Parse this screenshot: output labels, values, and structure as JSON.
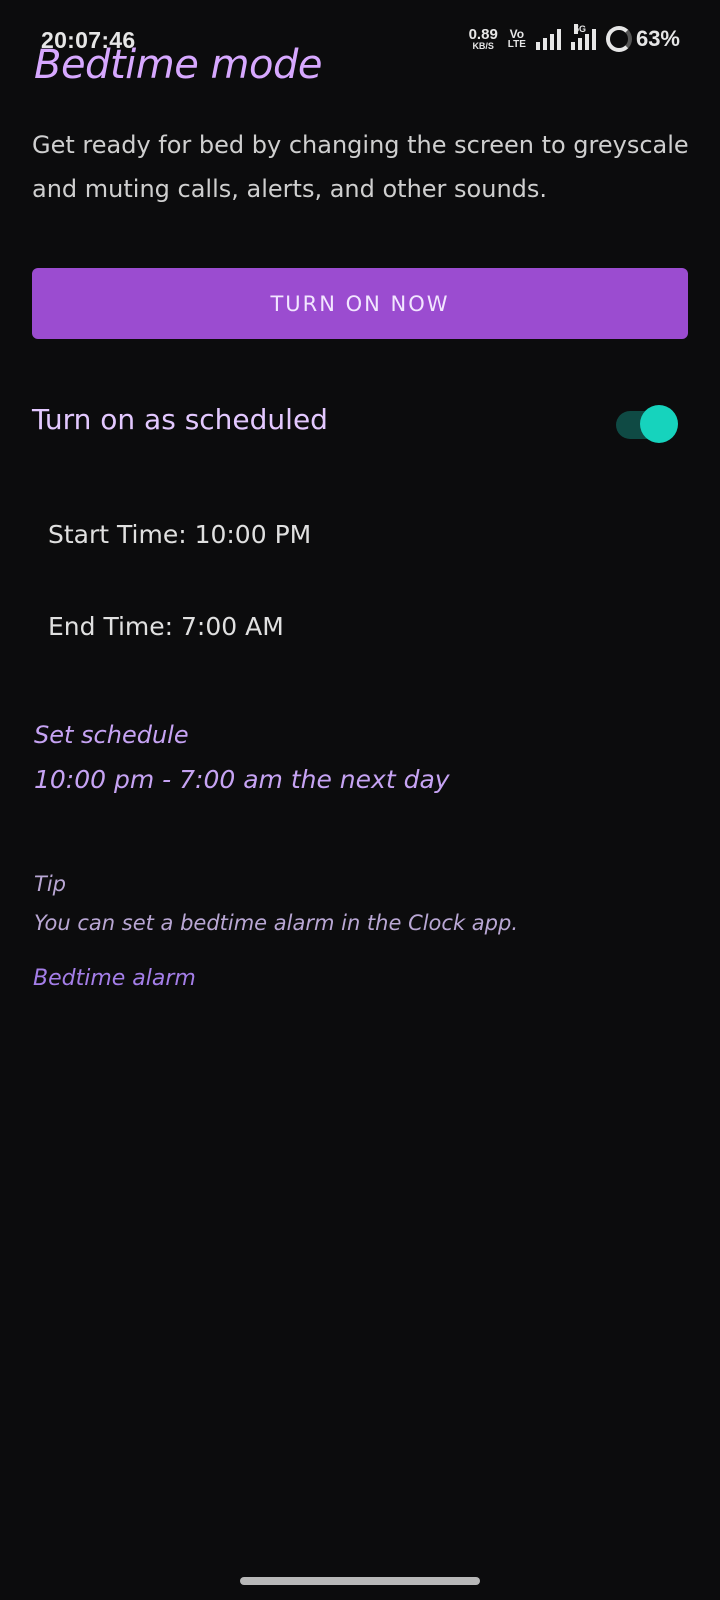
{
  "status_bar": {
    "time": "20:07:46",
    "net_speed_value": "0.89",
    "net_speed_unit": "KB/S",
    "volte_top": "Vo",
    "volte_bottom": "LTE",
    "network_5g": "5G",
    "battery": "63%",
    "battery_level": 0.63,
    "icons": [
      "signal-icon",
      "signal-5g-icon",
      "battery-icon"
    ]
  },
  "page": {
    "title": "Bedtime mode",
    "description": "Get ready for bed by changing the screen to greyscale and muting calls, alerts, and other sounds."
  },
  "actions": {
    "turn_on_now": "TURN ON NOW"
  },
  "schedule": {
    "toggle_label": "Turn on as scheduled",
    "toggle_on": true,
    "start_time": "Start Time: 10:00 PM",
    "end_time": "End Time: 7:00 AM",
    "set_schedule_title": "Set schedule",
    "set_schedule_range": "10:00 pm - 7:00 am the next day"
  },
  "tip": {
    "title": "Tip",
    "text": "You can set a bedtime alarm in the Clock app.",
    "link": "Bedtime alarm"
  },
  "colors": {
    "background": "#0c0c0d",
    "accent": "#9b4cd0",
    "title": "#d7a8ff",
    "toggle_on": "#16d3bd"
  }
}
